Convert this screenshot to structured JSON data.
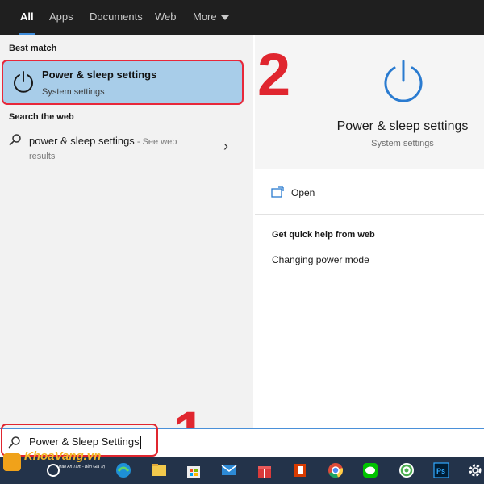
{
  "tabs": [
    {
      "label": "All",
      "active": true
    },
    {
      "label": "Apps"
    },
    {
      "label": "Documents"
    },
    {
      "label": "Web"
    },
    {
      "label": "More"
    }
  ],
  "best_match": {
    "section_title": "Best match",
    "title": "Power & sleep settings",
    "subtitle": "System settings"
  },
  "search_web": {
    "section_title": "Search the web",
    "query": "power & sleep settings",
    "see_results_prefix": " - See web",
    "see_results_suffix": "results"
  },
  "preview": {
    "title": "Power & sleep settings",
    "subtitle": "System settings",
    "open_label": "Open",
    "help_title": "Get quick help from web",
    "help_link": "Changing power mode"
  },
  "annotations": {
    "step1": "1",
    "step2": "2"
  },
  "search_box": {
    "value": "Power & Sleep Settings"
  },
  "taskbar": {
    "icons": [
      "cortana-icon",
      "edge-icon",
      "file-explorer-icon",
      "store-icon",
      "mail-icon",
      "gift-icon",
      "office-icon",
      "chrome-icon",
      "line-icon",
      "green-app-icon",
      "photoshop-icon",
      "settings-icon"
    ]
  },
  "watermark": {
    "brand": "KhoaVang.vn",
    "slogan": "Trao An Tâm - Bền Giá Trị"
  },
  "colors": {
    "accent": "#3d8bd9",
    "highlight": "#e0262f",
    "selected_bg": "#a8cde9",
    "taskbar": "#23334a"
  }
}
